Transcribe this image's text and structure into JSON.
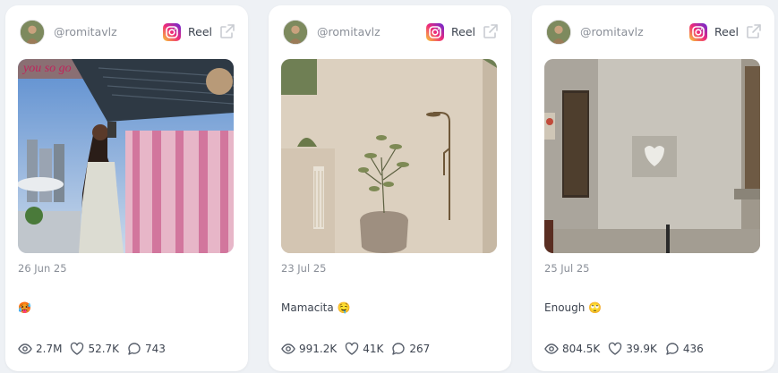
{
  "cards": [
    {
      "username": "@romitavlz",
      "platform": "Reel",
      "date": "26 Jun 25",
      "caption": "🥵",
      "stats": {
        "views": "2.7M",
        "likes": "52.7K",
        "comments": "743"
      }
    },
    {
      "username": "@romitavlz",
      "platform": "Reel",
      "date": "23 Jul 25",
      "caption": "Mamacita 🤤",
      "stats": {
        "views": "991.2K",
        "likes": "41K",
        "comments": "267"
      }
    },
    {
      "username": "@romitavlz",
      "platform": "Reel",
      "date": "25 Jul 25",
      "caption": "Enough 🙄",
      "stats": {
        "views": "804.5K",
        "likes": "39.9K",
        "comments": "436"
      }
    }
  ],
  "icons": {
    "platform": "instagram-icon",
    "open": "external-link-icon",
    "views": "eye-icon",
    "likes": "heart-icon",
    "comments": "comment-icon"
  },
  "colors": {
    "background": "#eef1f5",
    "card": "#ffffff",
    "muted_text": "#8a8f98",
    "text": "#3d4450"
  }
}
